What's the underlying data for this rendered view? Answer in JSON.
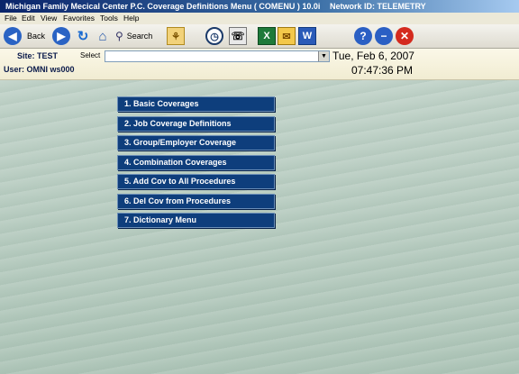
{
  "window": {
    "title": "Michigan Family Mecical Center P.C.  Coverage Definitions Menu  ( COMENU ) 10.0i",
    "network": "Network ID: TELEMETRY"
  },
  "menubar": [
    "File",
    "Edit",
    "View",
    "Favorites",
    "Tools",
    "Help"
  ],
  "toolbar": {
    "back_label": "Back",
    "search_label": "Search"
  },
  "info": {
    "site": "Site: TEST",
    "user": "User: OMNI ws000",
    "select_label": "Select",
    "select_value": "",
    "date": "Tue, Feb 6, 2007",
    "time": "07:47:36 PM"
  },
  "menu_items": [
    "1.  Basic Coverages",
    "2.  Job Coverage Definitions",
    "3.  Group/Employer Coverage",
    "4.  Combination Coverages",
    "5.  Add Cov to All Procedures",
    "6.  Del Cov from Procedures",
    "7.  Dictionary Menu"
  ],
  "colors": {
    "menu_button": "#0e3e7c",
    "background": "#b7ccc1",
    "title_bar": "#0a246a"
  }
}
